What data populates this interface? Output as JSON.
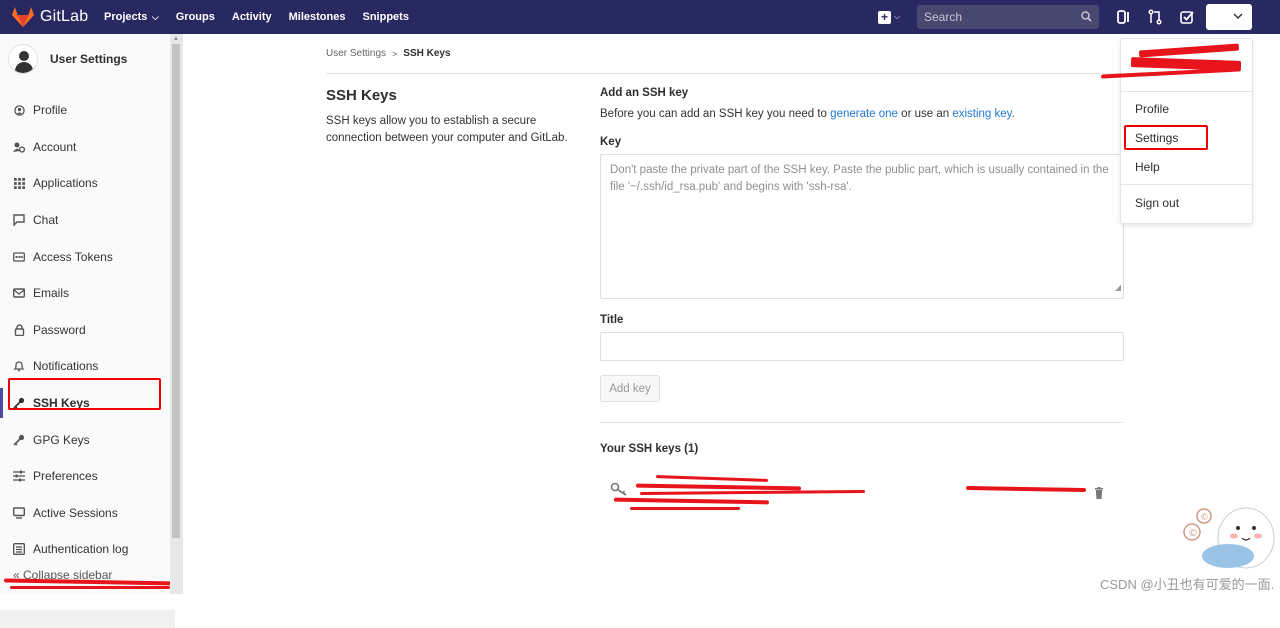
{
  "navbar": {
    "brand": "GitLab",
    "links": [
      "Projects",
      "Groups",
      "Activity",
      "Milestones",
      "Snippets"
    ],
    "search_placeholder": "Search",
    "colors": {
      "bg": "#292961",
      "search_bg": "#47476f"
    }
  },
  "sidebar": {
    "title": "User Settings",
    "items": [
      {
        "label": "Profile",
        "icon": "profile-icon"
      },
      {
        "label": "Account",
        "icon": "account-icon"
      },
      {
        "label": "Applications",
        "icon": "applications-icon"
      },
      {
        "label": "Chat",
        "icon": "chat-icon"
      },
      {
        "label": "Access Tokens",
        "icon": "access-tokens-icon"
      },
      {
        "label": "Emails",
        "icon": "email-icon"
      },
      {
        "label": "Password",
        "icon": "lock-icon"
      },
      {
        "label": "Notifications",
        "icon": "bell-icon"
      },
      {
        "label": "SSH Keys",
        "icon": "key-icon",
        "active": true
      },
      {
        "label": "GPG Keys",
        "icon": "key-icon"
      },
      {
        "label": "Preferences",
        "icon": "preferences-icon"
      },
      {
        "label": "Active Sessions",
        "icon": "monitor-icon"
      },
      {
        "label": "Authentication log",
        "icon": "log-icon"
      }
    ],
    "collapse_label": "Collapse sidebar"
  },
  "breadcrumb": {
    "parent": "User Settings",
    "separator": ">",
    "current": "SSH Keys"
  },
  "intro": {
    "title": "SSH Keys",
    "description": "SSH keys allow you to establish a secure connection between your computer and GitLab."
  },
  "form": {
    "heading": "Add an SSH key",
    "text_before": "Before you can add an SSH key you need to",
    "link_generate": "generate one",
    "text_middle": "or use an",
    "link_existing": "existing key",
    "text_after": ".",
    "key_label": "Key",
    "key_placeholder": "Don't paste the private part of the SSH key. Paste the public part, which is usually contained in the file '~/.ssh/id_rsa.pub' and begins with 'ssh-rsa'.",
    "title_label": "Title",
    "title_value": "",
    "add_button": "Add key"
  },
  "keys_section": {
    "title": "Your SSH keys (1)"
  },
  "user_dropdown": {
    "items": [
      "Profile",
      "Settings",
      "Help",
      "Sign out"
    ]
  },
  "watermark": "CSDN @小丑也有可爱的一面."
}
